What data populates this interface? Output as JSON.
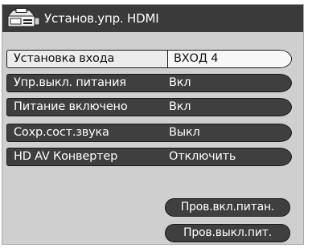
{
  "header": {
    "title": "Установ.упр. HDMI",
    "icon": "tv-settings-icon"
  },
  "rows": [
    {
      "label": "Установка входа",
      "value": "ВХОД 4"
    },
    {
      "label": "Упр.выкл. питания",
      "value": "Вкл"
    },
    {
      "label": "Питание включено",
      "value": "Вкл"
    },
    {
      "label": "Сохр.сост.звука",
      "value": "Выкл"
    },
    {
      "label": "HD AV Конвертер",
      "value": "Отключить"
    }
  ],
  "buttons": {
    "power_on_check": "Пров.вкл.питан.",
    "power_off_check": "Пров.выкл.пит."
  },
  "colors": {
    "panel": "#cfcfcf",
    "titlebar": "#3a3a3a",
    "row": "#3f3f3f",
    "selected_row": "#ececec"
  }
}
